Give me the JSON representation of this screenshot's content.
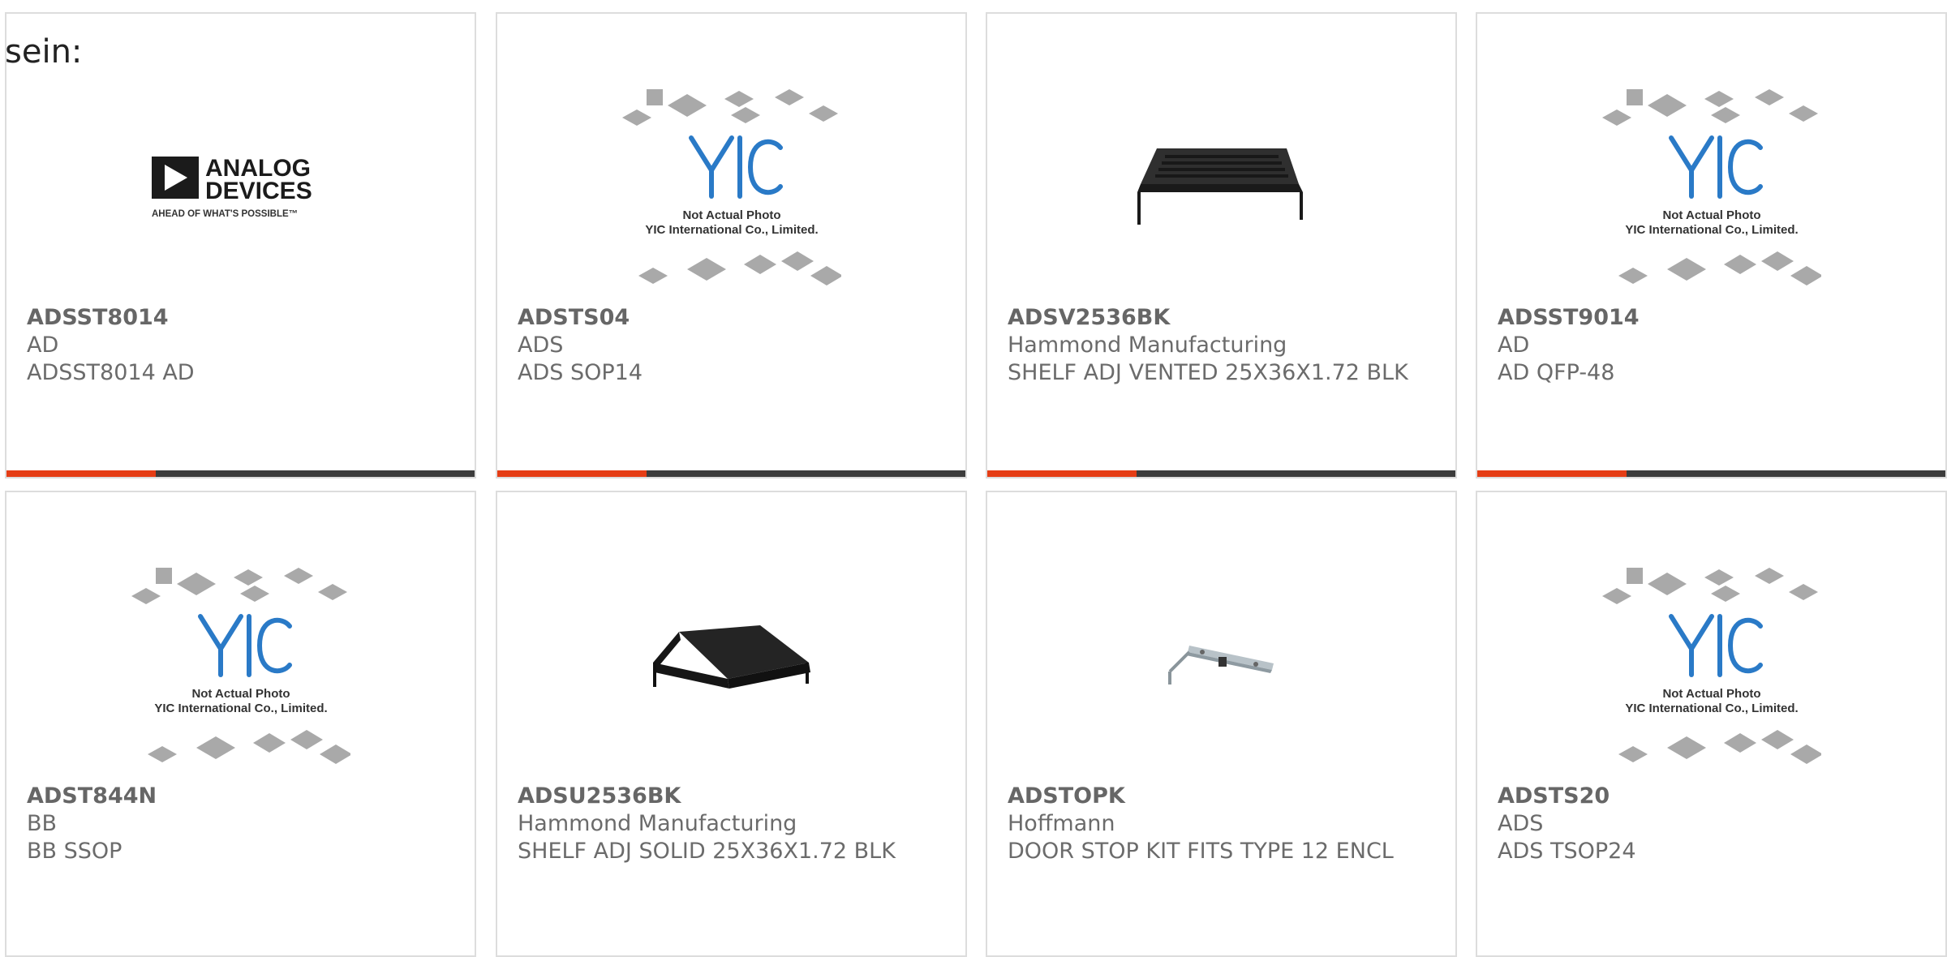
{
  "intro_text": "sein:",
  "colors": {
    "accent": "#e53d15",
    "bar": "#3c3c3c",
    "card_border": "#dddddd",
    "text": "#666666"
  },
  "logos": {
    "analog_devices": {
      "line1": "ANALOG",
      "line2": "DEVICES",
      "tagline": "AHEAD OF WHAT'S POSSIBLE™"
    },
    "yic": {
      "mark": "YIC",
      "line1": "Not Actual Photo",
      "line2": "YIC International Co., Limited."
    }
  },
  "products": [
    {
      "part": "ADSST8014",
      "mfr": "AD",
      "desc": "ADSST8014 AD",
      "image": "analog-devices-logo"
    },
    {
      "part": "ADSTS04",
      "mfr": "ADS",
      "desc": "ADS SOP14",
      "image": "yic-placeholder"
    },
    {
      "part": "ADSV2536BK",
      "mfr": "Hammond Manufacturing",
      "desc": "SHELF ADJ VENTED 25X36X1.72 BLK",
      "image": "vented-shelf"
    },
    {
      "part": "ADSST9014",
      "mfr": "AD",
      "desc": "AD QFP-48",
      "image": "yic-placeholder"
    },
    {
      "part": "ADST844N",
      "mfr": "BB",
      "desc": "BB SSOP",
      "image": "yic-placeholder"
    },
    {
      "part": "ADSU2536BK",
      "mfr": "Hammond Manufacturing",
      "desc": "SHELF ADJ SOLID 25X36X1.72 BLK",
      "image": "solid-shelf"
    },
    {
      "part": "ADSTOPK",
      "mfr": "Hoffmann",
      "desc": "DOOR STOP KIT FITS TYPE 12 ENCL",
      "image": "door-stop-kit"
    },
    {
      "part": "ADSTS20",
      "mfr": "ADS",
      "desc": "ADS TSOP24",
      "image": "yic-placeholder"
    }
  ]
}
